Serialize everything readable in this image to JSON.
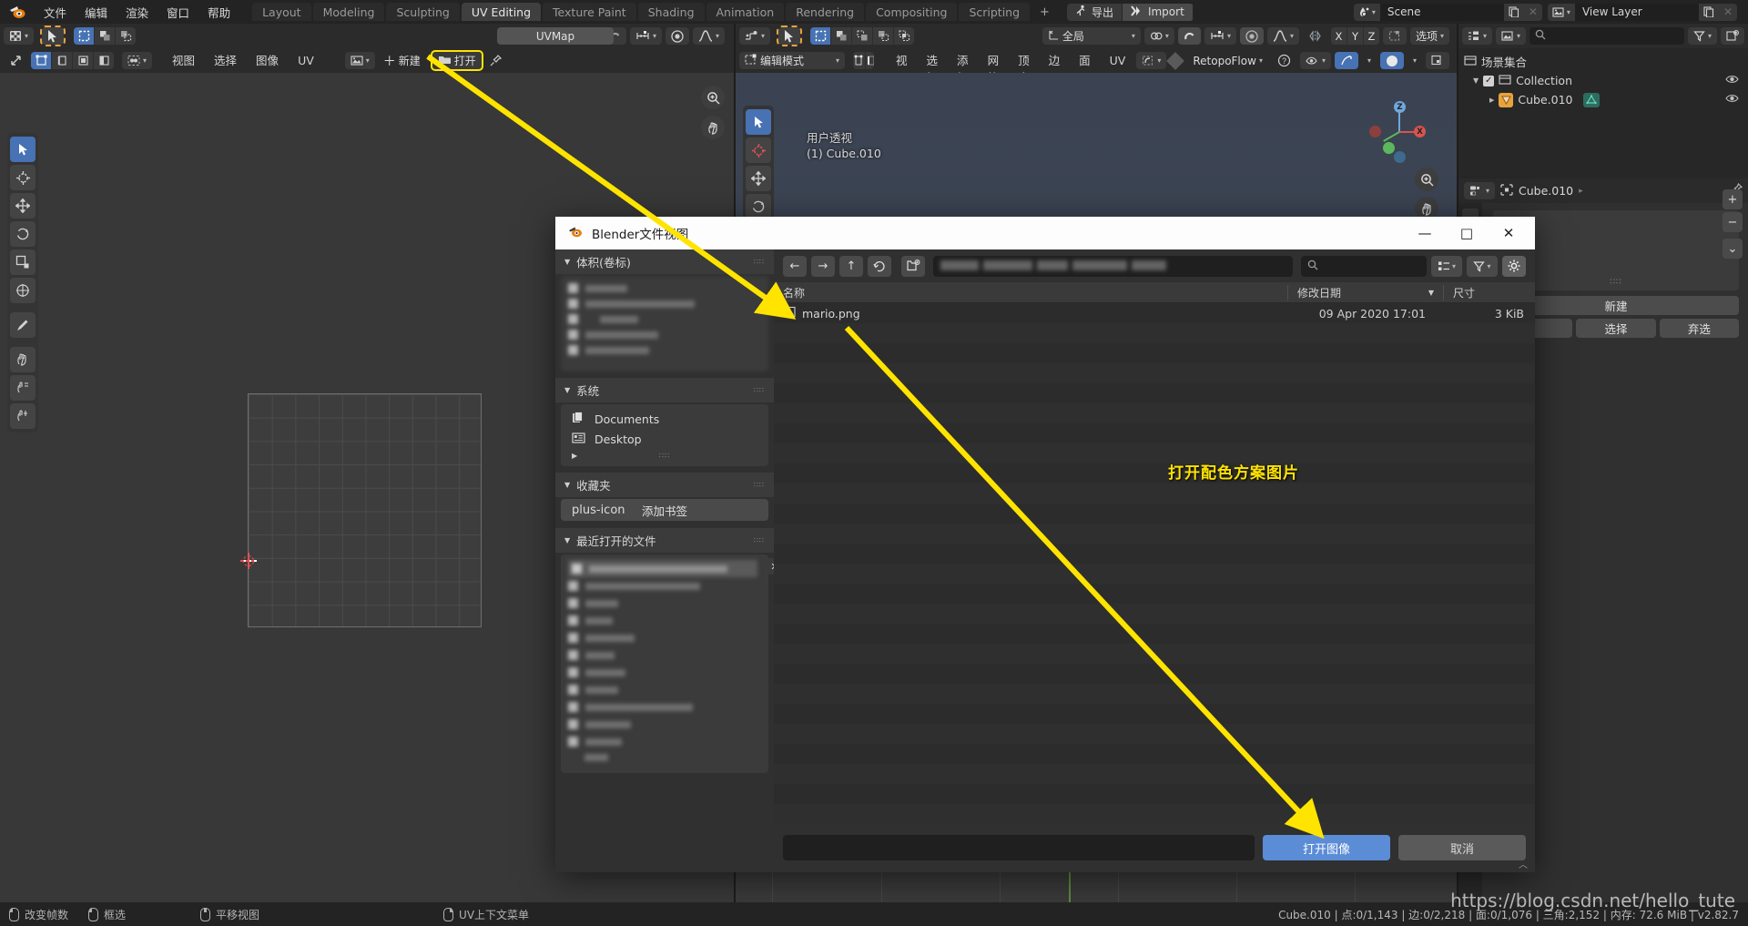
{
  "topbar": {
    "logo_icon": "blender-logo-icon",
    "menus": [
      "文件",
      "编辑",
      "渲染",
      "窗口",
      "帮助"
    ],
    "workspaces": [
      {
        "label": "Layout",
        "active": false
      },
      {
        "label": "Modeling",
        "active": false
      },
      {
        "label": "Sculpting",
        "active": false
      },
      {
        "label": "UV Editing",
        "active": true
      },
      {
        "label": "Texture Paint",
        "active": false
      },
      {
        "label": "Shading",
        "active": false
      },
      {
        "label": "Animation",
        "active": false
      },
      {
        "label": "Rendering",
        "active": false
      },
      {
        "label": "Compositing",
        "active": false
      },
      {
        "label": "Scripting",
        "active": false
      }
    ],
    "add_workspace": "+",
    "addons": [
      {
        "label": "导出",
        "icon": "export-runner-icon"
      },
      {
        "label": "Import",
        "icon": "import-arrows-icon"
      }
    ],
    "scene": {
      "name": "Scene",
      "icon": "scene-icon",
      "new_icon": "new-copy-icon",
      "unlink_icon": "x-icon"
    },
    "view_layer": {
      "name": "View Layer",
      "icon": "view-layer-icon",
      "new_icon": "new-copy-icon",
      "unlink_icon": "x-icon"
    }
  },
  "uv_editor": {
    "row1": {
      "editor_type_icon": "uv-editor-icon",
      "cursor_tool_icon": "cursor-arrow-icon",
      "select_modes": [
        "select-box-icon",
        "select-circle-icon",
        "select-lasso-icon"
      ],
      "right": {
        "pivot_icon": "pivot-point-icon",
        "snap_magnet_icon": "magnet-icon",
        "snap_target_icon": "snap-increment-icon",
        "proportional_icon": "proportional-edit-icon",
        "falloff_icon": "falloff-curve-icon"
      }
    },
    "row2": {
      "sync_icon": "uv-sync-icon",
      "uv_select_modes": [
        "vertex-icon",
        "edge-icon",
        "face-icon",
        "island-icon"
      ],
      "sticky_icon": "sticky-selection-icon",
      "menus": [
        "视图",
        "选择",
        "图像",
        "UV"
      ],
      "image_icon": "image-datablock-icon",
      "new_label": "新建",
      "open_label": "打开",
      "open_icon": "folder-open-icon",
      "pin_icon": "pin-icon"
    },
    "uvmap_field": "UVMap",
    "tools": [
      "tweak-tool-icon",
      "cursor-tool-icon",
      "move-tool-icon",
      "rotate-tool-icon",
      "scale-tool-icon",
      "transform-tool-icon",
      "annotate-tool-icon",
      "grab-tool-icon",
      "relax-tool-icon",
      "pinch-tool-icon"
    ],
    "zoom_icon": "zoom-icon",
    "pan_icon": "hand-pan-icon"
  },
  "viewport_3d": {
    "row1": {
      "editor_type_icon": "3d-viewport-icon",
      "cursor_tool_icon": "cursor-arrow-icon",
      "select_modes": [
        "select-box-icon",
        "select-extend-icon",
        "select-subtract-icon",
        "select-difference-icon",
        "select-intersect-icon"
      ],
      "transform_orientation": "全局",
      "orientation_icon": "orientation-axis-icon",
      "pivot_icon": "pivot-point-icon",
      "magnet_icon": "magnet-icon",
      "snap_icon": "snap-increment-icon",
      "proportional_icon": "proportional-edit-icon",
      "falloff_icon": "falloff-curve-icon",
      "mirror_icon": "mirror-icon",
      "axis_x": "X",
      "axis_y": "Y",
      "axis_z": "Z",
      "uv_mirror_icon": "uv-mirror-icon",
      "options_label": "选项"
    },
    "row2": {
      "mode": "编辑模式",
      "mode_icon": "edit-mode-icon",
      "select_mode_icons": [
        "vertex-select-icon",
        "edge-select-icon",
        "face-select-icon"
      ],
      "menus": [
        "视图",
        "选择",
        "添加",
        "网格",
        "顶点",
        "边",
        "面",
        "UV"
      ],
      "uv_dropdown_icon": "uv-dropdown-icon",
      "retopoflow_label": "RetopoFlow",
      "retopoflow_diamond_icon": "diamond-icon",
      "help_icon": "question-circle-icon",
      "overlay_icons": [
        "xray-eye-icon",
        "overlay-arc-icon",
        "shading-sphere-icon",
        "copy-icon"
      ]
    },
    "overlay": {
      "view_name": "用户透视",
      "object_name": "(1) Cube.010"
    },
    "gizmo": {
      "x": "X",
      "y": "Y",
      "z": "Z"
    },
    "right_tools": [
      "zoom-icon",
      "hand-pan-icon",
      "camera-icon",
      "ortho-icon"
    ]
  },
  "outliner": {
    "display_mode_icon": "outliner-display-icon",
    "filter_id_icon": "filter-id-icon",
    "search_icon": "search-icon",
    "filter_icon": "filter-funnel-icon",
    "new_collection_icon": "new-collection-icon",
    "scene_collection": "场景集合",
    "scene_collection_icon": "collection-box-icon",
    "rows": [
      {
        "label": "Collection",
        "icon": "collection-box-icon",
        "checkbox": true,
        "indent": 1,
        "eye_icon": "eye-icon",
        "expand": "▼"
      },
      {
        "label": "Cube.010",
        "icon": "mesh-data-triangle-icon",
        "checkbox": false,
        "indent": 2,
        "eye_icon": "eye-icon",
        "expand": "▶",
        "extra_icon": "mesh-data-icon"
      }
    ]
  },
  "properties": {
    "breadcrumb_icon": "object-properties-icon",
    "editor_icon": "properties-editor-icon",
    "object_name": "Cube.010",
    "pin_icon": "pin-icon",
    "side_buttons": [
      "+",
      "−",
      "⌄"
    ],
    "new_label": "新建",
    "select_label": "选择",
    "deselect_label": "弃选",
    "collapse_icon": "chevron-left-icon"
  },
  "file_dialog": {
    "title": "Blender文件视图",
    "title_icon": "blender-logo-icon",
    "window_buttons": {
      "minimize": "—",
      "maximize": "□",
      "close": "✕"
    },
    "sections": [
      {
        "label": "体积(卷标)",
        "blurred": true
      },
      {
        "label": "系统",
        "items": [
          {
            "label": "Documents",
            "icon": "documents-folder-icon"
          },
          {
            "label": "Desktop",
            "icon": "desktop-folder-icon"
          }
        ]
      },
      {
        "label": "收藏夹",
        "add_bookmark": "添加书签",
        "add_icon": "plus-icon"
      },
      {
        "label": "最近打开的文件",
        "blurred": true,
        "close_icon": "x-icon"
      }
    ],
    "nav": {
      "back_icon": "arrow-left-icon",
      "forward_icon": "arrow-right-icon",
      "up_icon": "arrow-up-icon",
      "refresh_icon": "refresh-icon",
      "new_folder_icon": "new-folder-icon",
      "path_value": "",
      "search_icon": "search-icon",
      "search_value": "",
      "display_mode_icon": "list-display-icon",
      "filter_icon": "filter-funnel-icon",
      "settings_icon": "gear-icon"
    },
    "columns": {
      "name": "名称",
      "date": "修改日期",
      "size": "尺寸",
      "sort_arrow": "▼"
    },
    "files": [
      {
        "name": "mario.png",
        "icon": "image-file-icon",
        "date": "09 Apr 2020 17:01",
        "size": "3 KiB"
      }
    ],
    "footer": {
      "filename_value": "",
      "confirm": "打开图像",
      "cancel": "取消"
    }
  },
  "annotation": {
    "text": "打开配色方案图片",
    "color": "#ffe400"
  },
  "statusbar": {
    "hints": [
      {
        "label": "改变帧数",
        "icon": "mouse-left-icon"
      },
      {
        "label": "框选",
        "icon": "mouse-left-drag-icon"
      },
      {
        "label": "平移视图",
        "icon": "mouse-middle-icon"
      },
      {
        "label": "UV上下文菜单",
        "icon": "mouse-right-icon"
      }
    ],
    "stats": "Cube.010 | 点:0/1,143 | 边:0/2,218 | 面:0/1,076 | 三角:2,152 | 内存: 72.6 MiB | v2.82.7"
  },
  "watermark": "https://blog.csdn.net/hello_tute"
}
